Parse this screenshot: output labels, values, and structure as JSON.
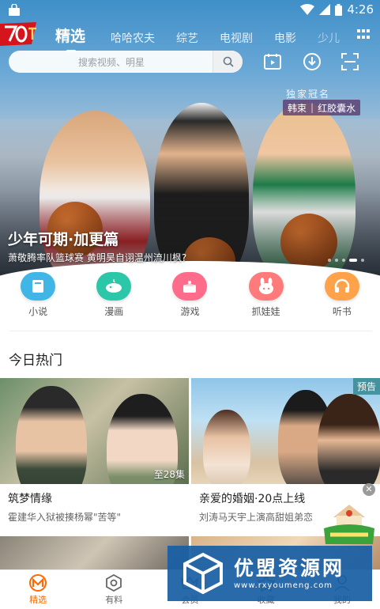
{
  "status_bar": {
    "time": "4:26"
  },
  "nav": {
    "tabs": [
      "精选",
      "哈哈农夫",
      "综艺",
      "电视剧",
      "电影",
      "少儿"
    ]
  },
  "search": {
    "placeholder": "搜索视频、明星"
  },
  "banner": {
    "exclusive_tag": "独家冠名",
    "sponsor_name": "韩束",
    "sponsor_product": "红胶囊水",
    "title": "少年可期·加更篇",
    "subtitle": "萧敬腾率队篮球赛 黄明昊自诩温州流川枫?",
    "page_count": 5,
    "current_page": 4
  },
  "categories": [
    {
      "label": "小说",
      "color": "#3fb6e6",
      "icon": "book-icon"
    },
    {
      "label": "漫画",
      "color": "#2cc7a8",
      "icon": "whale-icon"
    },
    {
      "label": "游戏",
      "color": "#ff6b8b",
      "icon": "cake-icon"
    },
    {
      "label": "抓娃娃",
      "color": "#ff7a7a",
      "icon": "bunny-icon"
    },
    {
      "label": "听书",
      "color": "#ffa24a",
      "icon": "headphone-icon"
    }
  ],
  "section": {
    "title": "今日热门"
  },
  "cards": [
    {
      "title": "筑梦情缘",
      "desc": "霍建华入狱被揍杨幂\"苦等\"",
      "badge": "至28集"
    },
    {
      "title": "亲爱的婚姻·20点上线",
      "desc": "刘涛马天宇上演高甜姐弟恋",
      "tag": "预告"
    }
  ],
  "bottom_nav": [
    {
      "label": "精选",
      "active": true,
      "icon": "home-m-icon"
    },
    {
      "label": "有料",
      "active": false,
      "icon": "discover-icon"
    },
    {
      "label": "会员",
      "active": false,
      "icon": "vip-icon"
    },
    {
      "label": "收藏",
      "active": false,
      "icon": "fav-icon"
    },
    {
      "label": "我的",
      "active": false,
      "icon": "profile-icon"
    }
  ],
  "watermark": {
    "brand": "优盟资源网",
    "url": "www.rxyoumeng.com"
  },
  "colors": {
    "accent": "#ff6a00",
    "watermark_bg": "#1a5fa5"
  }
}
